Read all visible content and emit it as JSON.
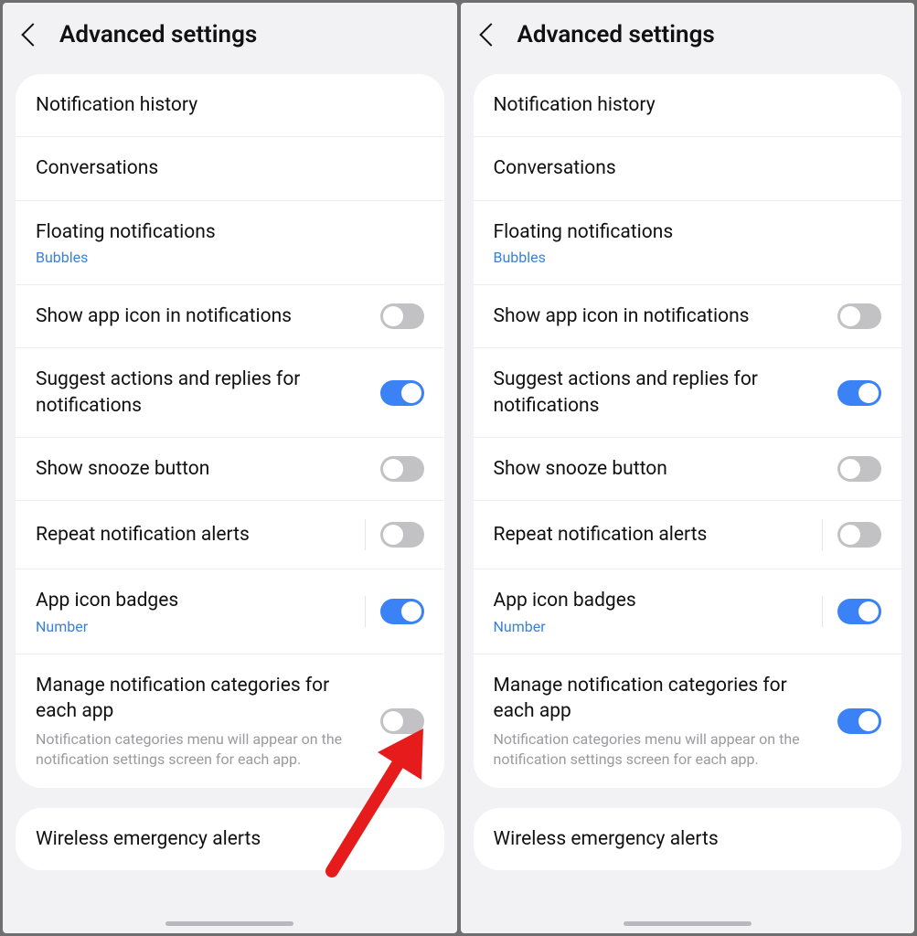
{
  "header": {
    "title": "Advanced settings"
  },
  "items": {
    "notification_history": {
      "label": "Notification history"
    },
    "conversations": {
      "label": "Conversations"
    },
    "floating": {
      "label": "Floating notifications",
      "sub": "Bubbles"
    },
    "show_app_icon": {
      "label": "Show app icon in notifications"
    },
    "suggest": {
      "label": "Suggest actions and replies for notifications"
    },
    "snooze": {
      "label": "Show snooze button"
    },
    "repeat": {
      "label": "Repeat notification alerts"
    },
    "badges": {
      "label": "App icon badges",
      "sub": "Number"
    },
    "manage_cat": {
      "label": "Manage notification categories for each app",
      "desc": "Notification categories menu will appear on the notification settings screen for each app."
    },
    "wireless": {
      "label": "Wireless emergency alerts"
    }
  },
  "toggles": {
    "left": {
      "show_app_icon": false,
      "suggest": true,
      "snooze": false,
      "repeat": false,
      "badges": true,
      "manage_cat": false
    },
    "right": {
      "show_app_icon": false,
      "suggest": true,
      "snooze": false,
      "repeat": false,
      "badges": true,
      "manage_cat": true
    }
  },
  "colors": {
    "accent": "#3b82f6",
    "link": "#3b82d6"
  }
}
